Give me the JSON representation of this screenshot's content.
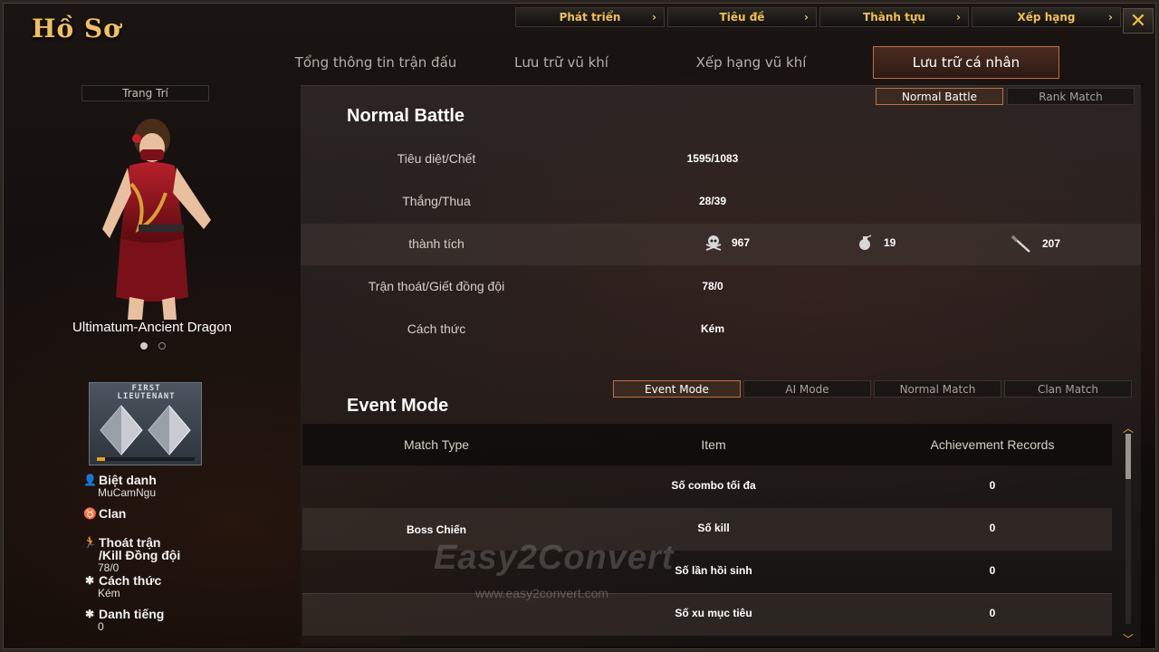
{
  "window": {
    "title": "Hồ Sơ"
  },
  "topnav": [
    {
      "label": "Phát triển"
    },
    {
      "label": "Tiêu đề"
    },
    {
      "label": "Thành tựu"
    },
    {
      "label": "Xếp hạng"
    }
  ],
  "tabs": [
    {
      "label": "Tổng thông tin trận đấu"
    },
    {
      "label": "Lưu trữ vũ khí"
    },
    {
      "label": "Xếp hạng vũ khí"
    },
    {
      "label": "Lưu trữ cá nhân",
      "active": true
    }
  ],
  "left": {
    "deco_label": "Trang Trí",
    "character_name": "Ultimatum-Ancient Dragon",
    "rank_title": "FIRST LIEUTENANT",
    "rank_line1": "FIRST",
    "rank_line2": "LIEUTENANT",
    "rank_progress": 0.08,
    "nickname_label": "Biệt danh",
    "nickname_value": "MuCamNgu",
    "clan_label": "Clan",
    "desert_label_line1": "Thoát trận",
    "desert_label_line2": "/Kill Đồng đội",
    "desert_value": "78/0",
    "style_label": "Cách thức",
    "style_value": "Kém",
    "reputation_label": "Danh tiếng",
    "reputation_value": "0"
  },
  "main": {
    "mode_toggle": {
      "normal": "Normal Battle",
      "rank": "Rank Match"
    },
    "normal_title": "Normal Battle",
    "stats": {
      "kd_label": "Tiêu diệt/Chết",
      "kd_value": "1595/1083",
      "wl_label": "Thắng/Thua",
      "wl_value": "28/39",
      "ach_label": "thành tích",
      "ach_headshot": "967",
      "ach_grenade": "19",
      "ach_knife": "207",
      "desert_label": "Trận thoát/Giết đồng đội",
      "desert_value": "78/0",
      "style_label": "Cách thức",
      "style_value": "Kém"
    },
    "event_title": "Event Mode",
    "event_tabs": [
      "Event Mode",
      "AI Mode",
      "Normal Match",
      "Clan Match"
    ],
    "table": {
      "headers": [
        "Match Type",
        "Item",
        "Achievement Records"
      ],
      "match_type": "Boss Chiến",
      "rows": [
        {
          "item": "Số combo tối đa",
          "record": "0"
        },
        {
          "item": "Số kill",
          "record": "0"
        },
        {
          "item": "Số lần hồi sinh",
          "record": "0"
        },
        {
          "item": "Số xu mục tiêu",
          "record": "0"
        }
      ]
    }
  },
  "watermark": {
    "brand": "Easy2Convert",
    "url": "www.easy2convert.com"
  },
  "colors": {
    "accent": "#f0c050",
    "active_border": "#c07040"
  }
}
